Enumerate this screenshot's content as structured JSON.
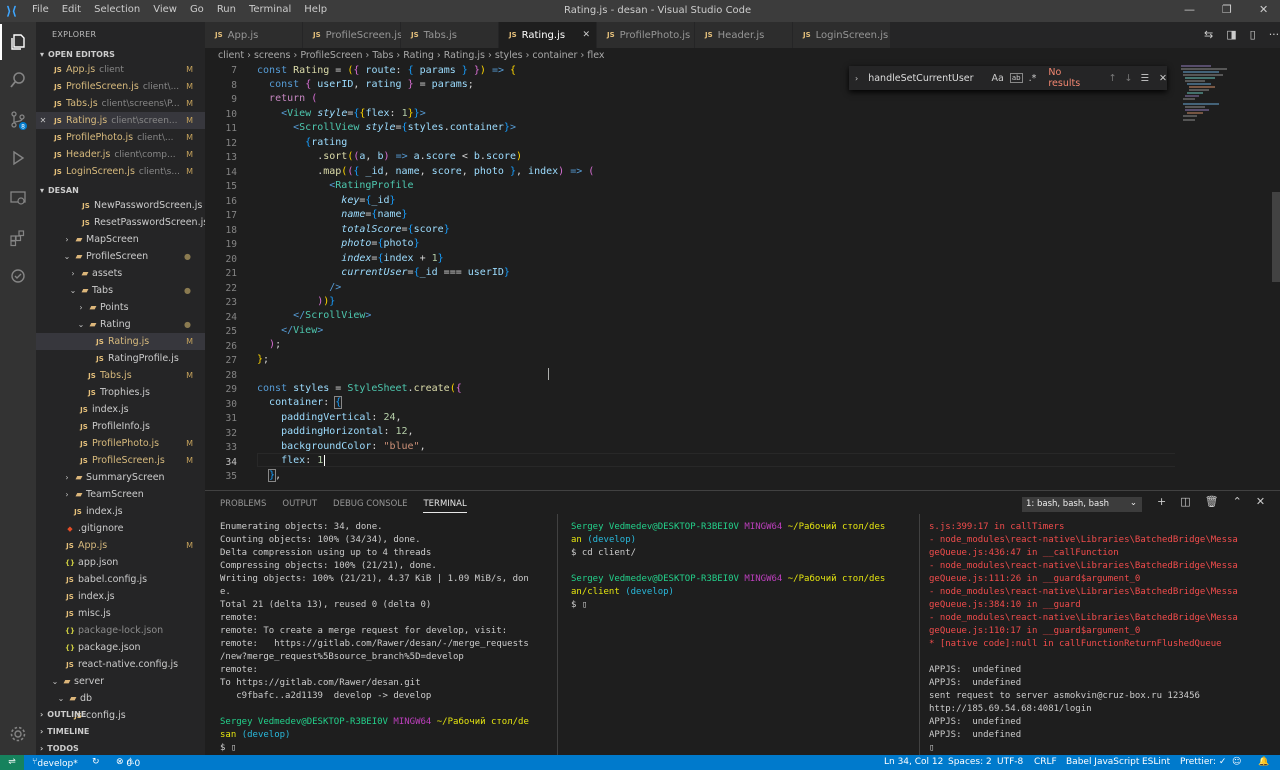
{
  "titlebar": {
    "menu": [
      "File",
      "Edit",
      "Selection",
      "View",
      "Go",
      "Run",
      "Terminal",
      "Help"
    ],
    "title": "Rating.js - desan - Visual Studio Code"
  },
  "explorer": {
    "title": "EXPLORER",
    "open_editors_label": "OPEN EDITORS",
    "open_editors": [
      {
        "name": "App.js",
        "dir": "client",
        "badge": "M"
      },
      {
        "name": "ProfileScreen.js",
        "dir": "client\\...",
        "badge": "M"
      },
      {
        "name": "Tabs.js",
        "dir": "client\\screens\\P...",
        "badge": "M"
      },
      {
        "name": "Rating.js",
        "dir": "client\\screen...",
        "badge": "M"
      },
      {
        "name": "ProfilePhoto.js",
        "dir": "client\\...",
        "badge": "M"
      },
      {
        "name": "Header.js",
        "dir": "client\\comp...",
        "badge": "M"
      },
      {
        "name": "LoginScreen.js",
        "dir": "client\\s...",
        "badge": "M"
      }
    ],
    "project_label": "DESAN",
    "tree": [
      {
        "name": "NewPasswordScreen.js",
        "type": "js"
      },
      {
        "name": "ResetPasswordScreen.js",
        "type": "js"
      },
      {
        "name": "MapScreen",
        "type": "folder"
      },
      {
        "name": "ProfileScreen",
        "type": "folder"
      },
      {
        "name": "assets",
        "type": "folder"
      },
      {
        "name": "Tabs",
        "type": "folder"
      },
      {
        "name": "Points",
        "type": "folder"
      },
      {
        "name": "Rating",
        "type": "folder"
      },
      {
        "name": "Rating.js",
        "type": "js",
        "badge": "M"
      },
      {
        "name": "RatingProfile.js",
        "type": "js"
      },
      {
        "name": "Tabs.js",
        "type": "js",
        "badge": "M"
      },
      {
        "name": "Trophies.js",
        "type": "js"
      },
      {
        "name": "index.js",
        "type": "js"
      },
      {
        "name": "ProfileInfo.js",
        "type": "js"
      },
      {
        "name": "ProfilePhoto.js",
        "type": "js",
        "badge": "M"
      },
      {
        "name": "ProfileScreen.js",
        "type": "js",
        "badge": "M"
      },
      {
        "name": "SummaryScreen",
        "type": "folder"
      },
      {
        "name": "TeamScreen",
        "type": "folder"
      },
      {
        "name": "index.js",
        "type": "js"
      },
      {
        "name": ".gitignore",
        "type": "git"
      },
      {
        "name": "App.js",
        "type": "js",
        "badge": "M"
      },
      {
        "name": "app.json",
        "type": "json"
      },
      {
        "name": "babel.config.js",
        "type": "js"
      },
      {
        "name": "index.js",
        "type": "js"
      },
      {
        "name": "misc.js",
        "type": "js"
      },
      {
        "name": "package-lock.json",
        "type": "json"
      },
      {
        "name": "package.json",
        "type": "json"
      },
      {
        "name": "react-native.config.js",
        "type": "js"
      },
      {
        "name": "server",
        "type": "folder"
      },
      {
        "name": "db",
        "type": "folder"
      },
      {
        "name": "config.js",
        "type": "js"
      }
    ],
    "bottom_sections": [
      "OUTLINE",
      "TIMELINE",
      "TODOS"
    ]
  },
  "tabs": [
    {
      "label": "App.js"
    },
    {
      "label": "ProfileScreen.js"
    },
    {
      "label": "Tabs.js"
    },
    {
      "label": "Rating.js",
      "active": true
    },
    {
      "label": "ProfilePhoto.js"
    },
    {
      "label": "Header.js"
    },
    {
      "label": "LoginScreen.js"
    }
  ],
  "breadcrumbs": [
    "client",
    "screens",
    "ProfileScreen",
    "Tabs",
    "Rating",
    "Rating.js",
    "styles",
    "container",
    "flex"
  ],
  "find": {
    "query": "handleSetCurrentUser",
    "result": "No results"
  },
  "editor": {
    "line_numbers": [
      "7",
      "8",
      "9",
      "10",
      "11",
      "12",
      "13",
      "14",
      "15",
      "16",
      "17",
      "18",
      "19",
      "20",
      "21",
      "22",
      "23",
      "24",
      "25",
      "26",
      "27",
      "28",
      "29",
      "30",
      "31",
      "32",
      "33",
      "34",
      "35"
    ]
  },
  "panel": {
    "tabs": [
      "PROBLEMS",
      "OUTPUT",
      "DEBUG CONSOLE",
      "TERMINAL"
    ],
    "active_tab": "TERMINAL",
    "terminal_select": "1: bash, bash, bash"
  },
  "terminal1": [
    "Enumerating objects: 34, done.",
    "Counting objects: 100% (34/34), done.",
    "Delta compression using up to 4 threads",
    "Compressing objects: 100% (21/21), done.",
    "Writing objects: 100% (21/21), 4.37 KiB | 1.09 MiB/s, don",
    "e.",
    "Total 21 (delta 13), reused 0 (delta 0)",
    "remote:",
    "remote: To create a merge request for develop, visit:",
    "remote:   https://gitlab.com/Rawer/desan/-/merge_requests",
    "/new?merge_request%5Bsource_branch%5D=develop",
    "remote:",
    "To https://gitlab.com/Rawer/desan.git",
    "   c9fbafc..a2d1139  develop -> develop"
  ],
  "terminal1_prompt": {
    "user": "Sergey Vedmedev@DESKTOP-R3BEI0V",
    "shell": "MINGW64",
    "path": "~/Рабочий стол/de",
    "path2": "san",
    "branch": "(develop)"
  },
  "terminal2": {
    "prompt1_user": "Sergey Vedmedev@DESKTOP-R3BEI0V",
    "shell": "MINGW64",
    "prompt1_path": "~/Рабочий стол/des",
    "prompt1_path2": "an",
    "branch": "(develop)",
    "cmd": "$ cd client/",
    "prompt2_path": "~/Рабочий стол/des",
    "prompt2_path2": "an/client"
  },
  "terminal3": [
    {
      "t": "s.js:399:17 in callTimers",
      "c": "rd"
    },
    {
      "t": "- node_modules\\react-native\\Libraries\\BatchedBridge\\Messa",
      "c": "rd"
    },
    {
      "t": "geQueue.js:436:47 in __callFunction",
      "c": "rd"
    },
    {
      "t": "- node_modules\\react-native\\Libraries\\BatchedBridge\\Messa",
      "c": "rd"
    },
    {
      "t": "geQueue.js:111:26 in __guard$argument_0",
      "c": "rd"
    },
    {
      "t": "- node_modules\\react-native\\Libraries\\BatchedBridge\\Messa",
      "c": "rd"
    },
    {
      "t": "geQueue.js:384:10 in __guard",
      "c": "rd"
    },
    {
      "t": "- node_modules\\react-native\\Libraries\\BatchedBridge\\Messa",
      "c": "rd"
    },
    {
      "t": "geQueue.js:110:17 in __guard$argument_0",
      "c": "rd"
    },
    {
      "t": "* [native code]:null in callFunctionReturnFlushedQueue",
      "c": "rd"
    },
    {
      "t": "",
      "c": ""
    },
    {
      "t": "APPJS:  undefined",
      "c": ""
    },
    {
      "t": "APPJS:  undefined",
      "c": ""
    },
    {
      "t": "sent request to server asmokvin@cruz-box.ru 123456",
      "c": ""
    },
    {
      "t": "http://185.69.54.68:4081/login",
      "c": ""
    },
    {
      "t": "APPJS:  undefined",
      "c": ""
    },
    {
      "t": "APPJS:  undefined",
      "c": ""
    }
  ],
  "status": {
    "branch": "develop*",
    "errors": "0",
    "warnings": "0",
    "position": "Ln 34, Col 12",
    "spaces": "Spaces: 2",
    "encoding": "UTF-8",
    "eol": "CRLF",
    "language": "Babel JavaScript",
    "eslint": "ESLint",
    "prettier": "Prettier: ✓"
  }
}
